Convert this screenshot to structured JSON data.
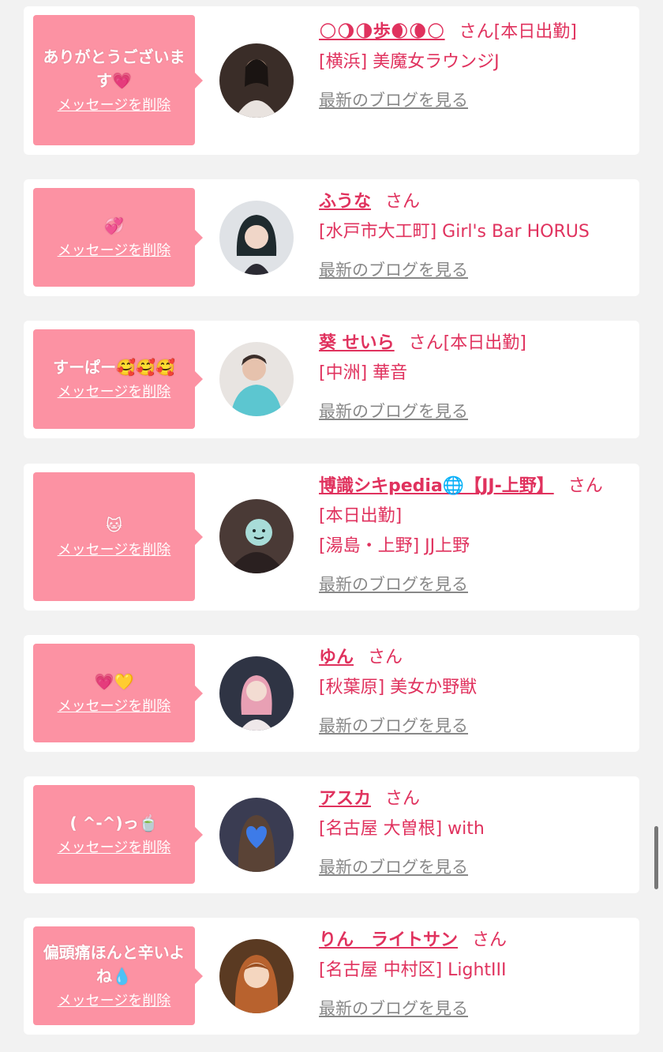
{
  "accent_color": "#e0325e",
  "bubble_color": "#fc92a3",
  "link_gray": "#888888",
  "entries": [
    {
      "message": "ありがとうございます💗",
      "delete_label": "メッセージを削除",
      "name": "🌕🌖🌗歩🌒🌘🌕",
      "suffix": "さん[本日出勤]",
      "shop": "[横浜] 美魔女ラウンジJ",
      "blog_label": "最新のブログを見る"
    },
    {
      "message": "💞",
      "delete_label": "メッセージを削除",
      "name": "ふうな",
      "suffix": "さん",
      "shop": "[水戸市大工町] Girl's Bar HORUS",
      "blog_label": "最新のブログを見る"
    },
    {
      "message": "すーぱー🥰🥰🥰",
      "delete_label": "メッセージを削除",
      "name": "葵 せいら",
      "suffix": "さん[本日出勤]",
      "shop": "[中洲] 華音",
      "blog_label": "最新のブログを見る"
    },
    {
      "message": "🐱",
      "delete_label": "メッセージを削除",
      "name": "博識シキpedia🌐【JJ-上野】",
      "suffix": "さん[本日出勤]",
      "shop": "[湯島・上野] JJ上野",
      "blog_label": "最新のブログを見る"
    },
    {
      "message": "💗💛",
      "delete_label": "メッセージを削除",
      "name": "ゆん",
      "suffix": "さん",
      "shop": "[秋葉原] 美女か野獣",
      "blog_label": "最新のブログを見る"
    },
    {
      "message": "( ^-^)っ🍵",
      "delete_label": "メッセージを削除",
      "name": "アスカ",
      "suffix": "さん",
      "shop": "[名古屋 大曽根] with",
      "blog_label": "最新のブログを見る"
    },
    {
      "message": "偏頭痛ほんと辛いよね💧",
      "delete_label": "メッセージを削除",
      "name": "りん　ライトサン",
      "suffix": "さん",
      "shop": "[名古屋 中村区] LightIII",
      "blog_label": "最新のブログを見る"
    }
  ]
}
